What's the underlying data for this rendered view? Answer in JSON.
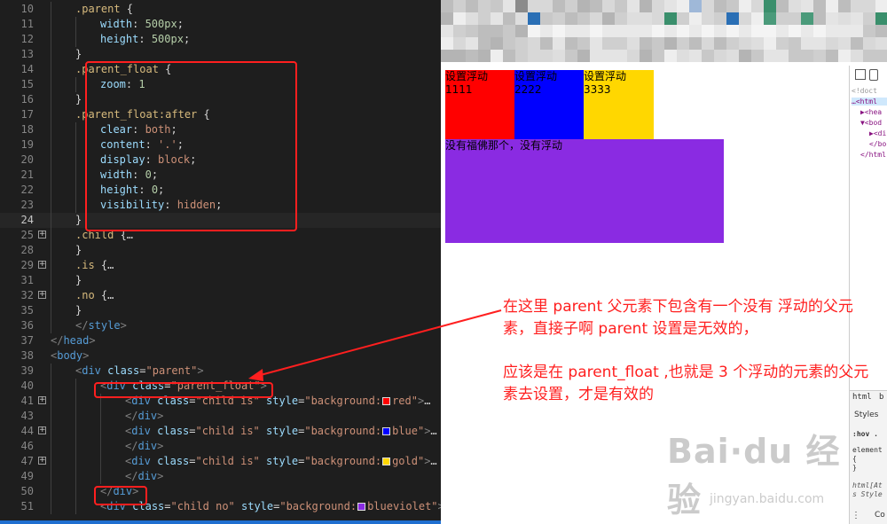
{
  "editor": {
    "lines": [
      {
        "n": "10",
        "indent": 1,
        "tokens": [
          [
            "sel",
            ".parent"
          ],
          [
            "pun",
            " {"
          ]
        ]
      },
      {
        "n": "11",
        "indent": 2,
        "tokens": [
          [
            "prop",
            "width"
          ],
          [
            "pun",
            ": "
          ],
          [
            "num",
            "500px"
          ],
          [
            "pun",
            ";"
          ]
        ]
      },
      {
        "n": "12",
        "indent": 2,
        "tokens": [
          [
            "prop",
            "height"
          ],
          [
            "pun",
            ": "
          ],
          [
            "num",
            "500px"
          ],
          [
            "pun",
            ";"
          ]
        ]
      },
      {
        "n": "13",
        "indent": 1,
        "tokens": [
          [
            "pun",
            "}"
          ]
        ]
      },
      {
        "n": "14",
        "indent": 1,
        "tokens": [
          [
            "sel",
            ".parent_float"
          ],
          [
            "pun",
            " {"
          ]
        ]
      },
      {
        "n": "15",
        "indent": 2,
        "tokens": [
          [
            "prop",
            "zoom"
          ],
          [
            "pun",
            ": "
          ],
          [
            "num",
            "1"
          ]
        ]
      },
      {
        "n": "16",
        "indent": 1,
        "tokens": [
          [
            "pun",
            "}"
          ]
        ]
      },
      {
        "n": "17",
        "indent": 1,
        "tokens": [
          [
            "sel",
            ".parent_float:after"
          ],
          [
            "pun",
            " {"
          ]
        ]
      },
      {
        "n": "18",
        "indent": 2,
        "tokens": [
          [
            "prop",
            "clear"
          ],
          [
            "pun",
            ": "
          ],
          [
            "val",
            "both"
          ],
          [
            "pun",
            ";"
          ]
        ]
      },
      {
        "n": "19",
        "indent": 2,
        "tokens": [
          [
            "prop",
            "content"
          ],
          [
            "pun",
            ": "
          ],
          [
            "val",
            "'.'"
          ],
          [
            "pun",
            ";"
          ]
        ]
      },
      {
        "n": "20",
        "indent": 2,
        "tokens": [
          [
            "prop",
            "display"
          ],
          [
            "pun",
            ": "
          ],
          [
            "val",
            "block"
          ],
          [
            "pun",
            ";"
          ]
        ]
      },
      {
        "n": "21",
        "indent": 2,
        "tokens": [
          [
            "prop",
            "width"
          ],
          [
            "pun",
            ": "
          ],
          [
            "num",
            "0"
          ],
          [
            "pun",
            ";"
          ]
        ]
      },
      {
        "n": "22",
        "indent": 2,
        "tokens": [
          [
            "prop",
            "height"
          ],
          [
            "pun",
            ": "
          ],
          [
            "num",
            "0"
          ],
          [
            "pun",
            ";"
          ]
        ]
      },
      {
        "n": "23",
        "indent": 2,
        "tokens": [
          [
            "prop",
            "visibility"
          ],
          [
            "pun",
            ": "
          ],
          [
            "val",
            "hidden"
          ],
          [
            "pun",
            ";"
          ]
        ]
      },
      {
        "n": "24",
        "indent": 1,
        "current": true,
        "tokens": [
          [
            "pun",
            "}"
          ]
        ]
      },
      {
        "n": "25",
        "indent": 1,
        "fold": true,
        "tokens": [
          [
            "sel",
            ".child"
          ],
          [
            "pun",
            " {…"
          ]
        ]
      },
      {
        "n": "28",
        "indent": 1,
        "tokens": [
          [
            "pun",
            "}"
          ]
        ]
      },
      {
        "n": "29",
        "indent": 1,
        "fold": true,
        "tokens": [
          [
            "sel",
            ".is"
          ],
          [
            "pun",
            " {…"
          ]
        ]
      },
      {
        "n": "31",
        "indent": 1,
        "tokens": [
          [
            "pun",
            "}"
          ]
        ]
      },
      {
        "n": "32",
        "indent": 1,
        "fold": true,
        "tokens": [
          [
            "sel",
            ".no"
          ],
          [
            "pun",
            " {…"
          ]
        ]
      },
      {
        "n": "35",
        "indent": 1,
        "tokens": [
          [
            "pun",
            "}"
          ]
        ]
      },
      {
        "n": "36",
        "indent": 1,
        "tokens": [
          [
            "angle",
            "</"
          ],
          [
            "tag",
            "style"
          ],
          [
            "angle",
            ">"
          ]
        ]
      },
      {
        "n": "37",
        "indent": 0,
        "tokens": [
          [
            "angle",
            "</"
          ],
          [
            "tag",
            "head"
          ],
          [
            "angle",
            ">"
          ]
        ]
      },
      {
        "n": "38",
        "indent": 0,
        "tokens": [
          [
            "angle",
            "<"
          ],
          [
            "tag",
            "body"
          ],
          [
            "angle",
            ">"
          ]
        ]
      },
      {
        "n": "39",
        "indent": 1,
        "tokens": [
          [
            "angle",
            "<"
          ],
          [
            "tag",
            "div"
          ],
          [
            "attr",
            " class"
          ],
          [
            "pun",
            "="
          ],
          [
            "str",
            "\"parent\""
          ],
          [
            "angle",
            ">"
          ]
        ]
      },
      {
        "n": "40",
        "indent": 2,
        "tokens": [
          [
            "angle",
            "<"
          ],
          [
            "tag",
            "div"
          ],
          [
            "attr",
            " class"
          ],
          [
            "pun",
            "="
          ],
          [
            "str",
            "\"parent_float\""
          ],
          [
            "angle",
            ">"
          ]
        ]
      },
      {
        "n": "41",
        "indent": 3,
        "fold": true,
        "tokens": [
          [
            "angle",
            "<"
          ],
          [
            "tag",
            "div"
          ],
          [
            "attr",
            " class"
          ],
          [
            "pun",
            "="
          ],
          [
            "str",
            "\"child is\""
          ],
          [
            "attr",
            " style"
          ],
          [
            "pun",
            "="
          ],
          [
            "str",
            "\"background:"
          ],
          [
            "swatch",
            "#ff0000"
          ],
          [
            "str",
            "red\""
          ],
          [
            "angle",
            ">"
          ],
          [
            "pun",
            "…"
          ]
        ]
      },
      {
        "n": "43",
        "indent": 3,
        "tokens": [
          [
            "angle",
            "</"
          ],
          [
            "tag",
            "div"
          ],
          [
            "angle",
            ">"
          ]
        ]
      },
      {
        "n": "44",
        "indent": 3,
        "fold": true,
        "tokens": [
          [
            "angle",
            "<"
          ],
          [
            "tag",
            "div"
          ],
          [
            "attr",
            " class"
          ],
          [
            "pun",
            "="
          ],
          [
            "str",
            "\"child is\""
          ],
          [
            "attr",
            " style"
          ],
          [
            "pun",
            "="
          ],
          [
            "str",
            "\"background:"
          ],
          [
            "swatch",
            "#0000ff"
          ],
          [
            "str",
            "blue\""
          ],
          [
            "angle",
            ">"
          ],
          [
            "pun",
            "…"
          ]
        ]
      },
      {
        "n": "46",
        "indent": 3,
        "tokens": [
          [
            "angle",
            "</"
          ],
          [
            "tag",
            "div"
          ],
          [
            "angle",
            ">"
          ]
        ]
      },
      {
        "n": "47",
        "indent": 3,
        "fold": true,
        "tokens": [
          [
            "angle",
            "<"
          ],
          [
            "tag",
            "div"
          ],
          [
            "attr",
            " class"
          ],
          [
            "pun",
            "="
          ],
          [
            "str",
            "\"child is\""
          ],
          [
            "attr",
            " style"
          ],
          [
            "pun",
            "="
          ],
          [
            "str",
            "\"background:"
          ],
          [
            "swatch",
            "#ffd700"
          ],
          [
            "str",
            "gold\""
          ],
          [
            "angle",
            ">"
          ],
          [
            "pun",
            "…"
          ]
        ]
      },
      {
        "n": "49",
        "indent": 3,
        "tokens": [
          [
            "angle",
            "</"
          ],
          [
            "tag",
            "div"
          ],
          [
            "angle",
            ">"
          ]
        ]
      },
      {
        "n": "50",
        "indent": 2,
        "tokens": [
          [
            "angle",
            "</"
          ],
          [
            "tag",
            "div"
          ],
          [
            "angle",
            ">"
          ]
        ]
      },
      {
        "n": "51",
        "indent": 2,
        "tokens": [
          [
            "angle",
            "<"
          ],
          [
            "tag",
            "div"
          ],
          [
            "attr",
            " class"
          ],
          [
            "pun",
            "="
          ],
          [
            "str",
            "\"child no\""
          ],
          [
            "attr",
            " style"
          ],
          [
            "pun",
            "="
          ],
          [
            "str",
            "\"background:"
          ],
          [
            "swatch",
            "#8a2be2"
          ],
          [
            "str",
            "blueviolet\""
          ],
          [
            "angle",
            ">"
          ]
        ]
      }
    ]
  },
  "preview": {
    "boxes": [
      {
        "color": "#ff0000",
        "label": "设置浮动",
        "num": "1111"
      },
      {
        "color": "#0000ff",
        "label": "设置浮动",
        "num": "2222"
      },
      {
        "color": "#ffd700",
        "label": "设置浮动",
        "num": "3333"
      }
    ],
    "no_float": {
      "color": "#8a2be2",
      "label": "没有福佛那个，没有浮动"
    }
  },
  "devtools": {
    "lines": [
      "<!doct",
      "…<html",
      "▶<hea",
      "▼<bod",
      "▶<di",
      "</bo",
      "</html"
    ],
    "tab_html": "html",
    "tab_b": "b",
    "styles": "Styles",
    "hov": ":hov .",
    "element": "element",
    "brace_open": "{",
    "brace_close": "}",
    "attr_rule": "html[At",
    "style_src": "s Style",
    "more": "Co"
  },
  "annotation": {
    "para1": "在这里 parent 父元素下包含有一个没有 浮动的父元素，直接子啊 parent 设置是无效的，",
    "para2": "应该是在 parent_float ,也就是 3 个浮动的元素的父元素去设置，才是有效的"
  },
  "watermark": {
    "logo": "Bai·du 经验",
    "url": "jingyan.baidu.com"
  },
  "colors": {
    "accent_red": "#ff1f1f"
  }
}
